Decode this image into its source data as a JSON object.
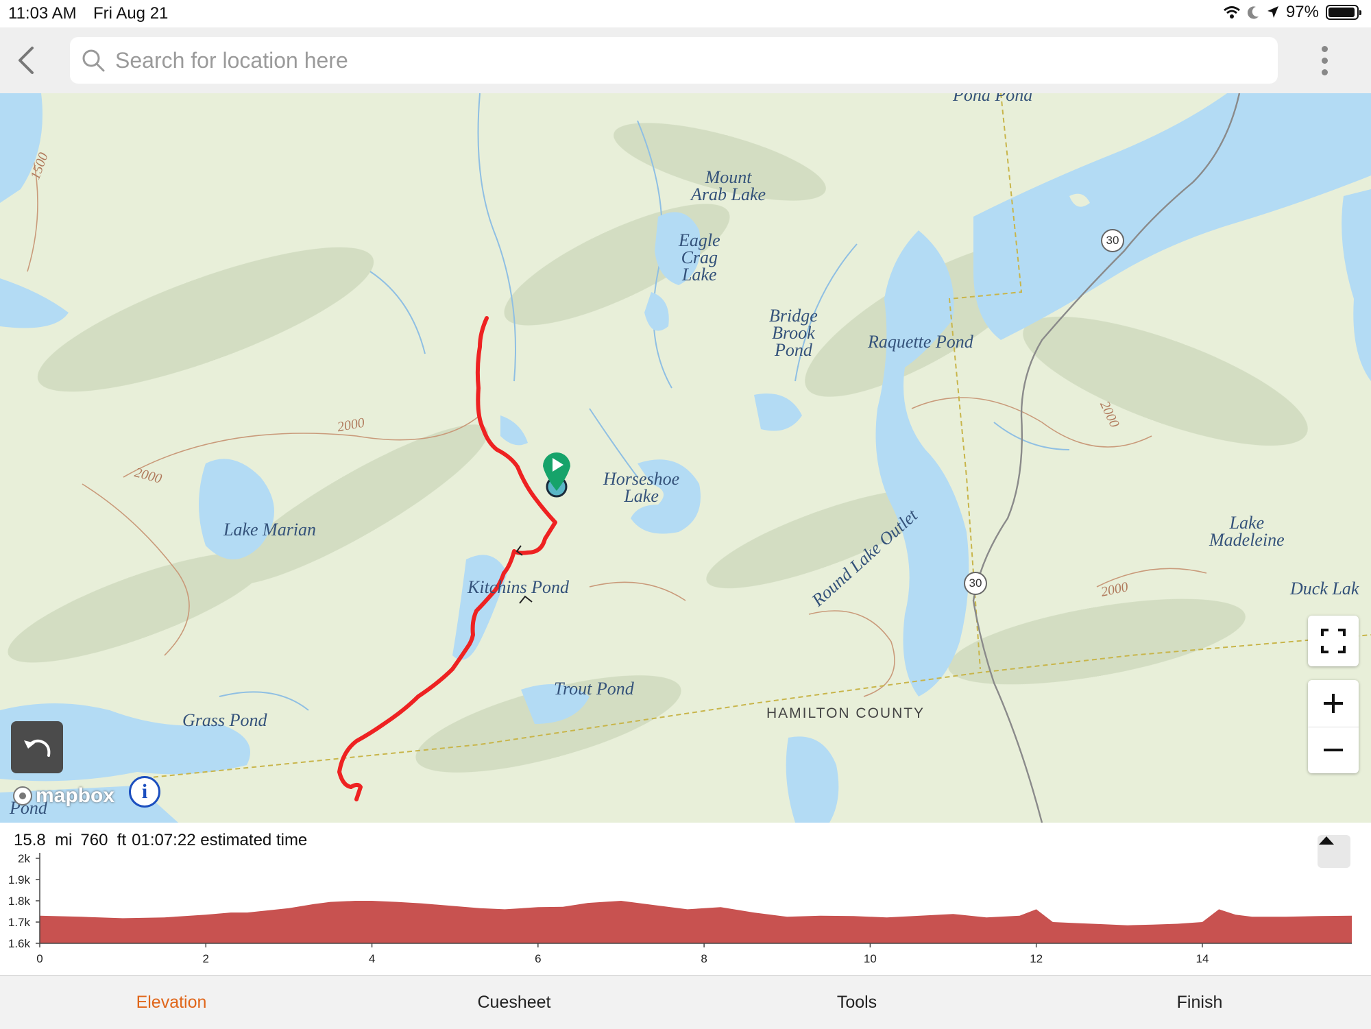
{
  "status_bar": {
    "time": "11:03 AM",
    "date": "Fri Aug 21",
    "battery": "97%"
  },
  "search": {
    "placeholder": "Search for location here",
    "value": ""
  },
  "map": {
    "labels": {
      "mount_arab_lake": "Mount\nArab Lake",
      "eagle_crag_lake": "Eagle\nCrag\nLake",
      "bridge_brook_pond": "Bridge\nBrook\nPond",
      "raquette_pond": "Raquette Pond",
      "horseshoe_lake": "Horseshoe\nLake",
      "lake_marian": "Lake Marian",
      "kitchins_pond": "Kitchins Pond",
      "trout_pond": "Trout Pond",
      "grass_pond": "Grass Pond",
      "round_lake_outlet": "Round Lake Outlet",
      "hamilton_county": "HAMILTON COUNTY",
      "lake_madeleine": "Lake\nMadeleine",
      "duck_lake": "Duck Lak",
      "pond_top": "Pond   Pond",
      "pond_bottom": "Pond"
    },
    "contours": {
      "c1": "2000",
      "c2": "2000",
      "c3": "2000",
      "c4": "2000",
      "c5": "1500"
    },
    "route_shields": {
      "r1": "30",
      "r2": "30"
    },
    "attribution": "mapbox",
    "info_icon": "i",
    "route_color": "#ee2222",
    "water_color": "#b3dbf4",
    "land_color": "#e8efd9"
  },
  "elevation": {
    "distance_value": "15.8",
    "distance_unit": "mi",
    "gain_value": "760",
    "gain_unit": "ft",
    "time_value": "01:07:22",
    "time_label": "estimated time",
    "y_ticks": [
      "2k",
      "1.9k",
      "1.8k",
      "1.7k",
      "1.6k"
    ],
    "x_ticks": [
      "0",
      "2",
      "4",
      "6",
      "8",
      "10",
      "12",
      "14"
    ],
    "fill_color": "#c85250"
  },
  "chart_data": {
    "type": "area",
    "xlabel": "",
    "ylabel": "",
    "xlim": [
      0,
      15.8
    ],
    "ylim": [
      1600,
      2000
    ],
    "x": [
      0,
      0.5,
      1.0,
      1.5,
      2.0,
      2.3,
      2.5,
      3.0,
      3.3,
      3.5,
      3.8,
      4.0,
      4.3,
      4.6,
      5.0,
      5.3,
      5.6,
      6.0,
      6.3,
      6.6,
      7.0,
      7.4,
      7.8,
      8.2,
      8.6,
      9.0,
      9.4,
      9.8,
      10.2,
      10.6,
      11.0,
      11.4,
      11.8,
      12.0,
      12.2,
      12.5,
      12.8,
      13.1,
      13.4,
      13.7,
      14.0,
      14.2,
      14.4,
      14.6,
      15.0,
      15.4,
      15.8
    ],
    "series": [
      {
        "values": [
          1730,
          1725,
          1718,
          1722,
          1735,
          1745,
          1745,
          1765,
          1785,
          1795,
          1800,
          1800,
          1795,
          1788,
          1775,
          1765,
          1760,
          1770,
          1772,
          1790,
          1800,
          1780,
          1760,
          1770,
          1745,
          1725,
          1730,
          1728,
          1722,
          1730,
          1738,
          1722,
          1730,
          1760,
          1700,
          1695,
          1690,
          1685,
          1688,
          1692,
          1700,
          1760,
          1735,
          1725,
          1725,
          1728,
          1730
        ]
      }
    ]
  },
  "tabs": [
    {
      "label": "Elevation"
    },
    {
      "label": "Cuesheet"
    },
    {
      "label": "Tools"
    },
    {
      "label": "Finish"
    }
  ]
}
